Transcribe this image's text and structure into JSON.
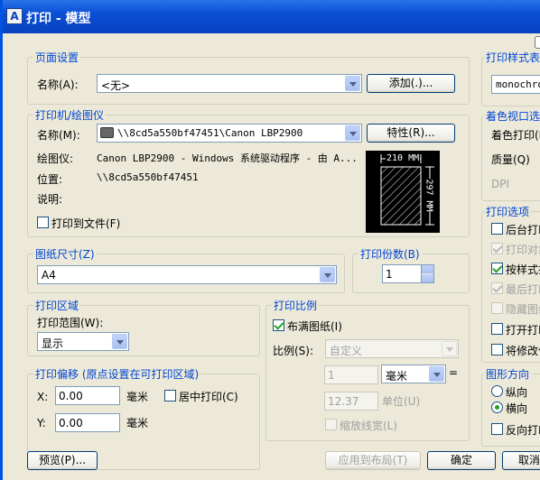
{
  "window": {
    "title": "打印 - 模型",
    "app_icon": "autocad-icon"
  },
  "page_setup": {
    "title": "页面设置",
    "name_label": "名称(A):",
    "name_value": "<无>",
    "add_button": "添加(.)..."
  },
  "printer": {
    "title": "打印机/绘图仪",
    "name_label": "名称(M):",
    "name_value": "\\\\8cd5a550bf47451\\Canon LBP2900",
    "properties_button": "特性(R)...",
    "plotter_label": "绘图仪:",
    "plotter_value": "Canon LBP2900 - Windows 系统驱动程序 - 由 A...",
    "location_label": "位置:",
    "location_value": "\\\\8cd5a550bf47451",
    "description_label": "说明:",
    "plot_to_file": "打印到文件(F)",
    "plot_to_file_checked": false
  },
  "preview": {
    "width_label": "210 MM",
    "height_label": "297 MM"
  },
  "paper_size": {
    "title": "图纸尺寸(Z)",
    "value": "A4"
  },
  "copies": {
    "title": "打印份数(B)",
    "value": "1"
  },
  "plot_area": {
    "title": "打印区域",
    "range_label": "打印范围(W):",
    "range_value": "显示"
  },
  "plot_offset": {
    "title": "打印偏移 (原点设置在可打印区域)",
    "x_label": "X:",
    "x_value": "0.00",
    "x_unit": "毫米",
    "y_label": "Y:",
    "y_value": "0.00",
    "y_unit": "毫米",
    "center": "居中打印(C)",
    "center_checked": false
  },
  "plot_scale": {
    "title": "打印比例",
    "fit": "布满图纸(I)",
    "fit_checked": true,
    "scale_label": "比例(S):",
    "scale_value": "自定义",
    "value1": "1",
    "unit": "毫米",
    "equals": "=",
    "value2": "12.37",
    "unit2": "单位(U)",
    "lineweights": "缩放线宽(L)",
    "lineweights_checked": false
  },
  "plot_style": {
    "title": "打印样式表",
    "value": "monochrome"
  },
  "shaded": {
    "title": "着色视口选项",
    "shade_label": "着色打印(D)",
    "quality_label": "质量(Q)",
    "dpi_label": "DPI"
  },
  "plot_options": {
    "title": "打印选项",
    "items": [
      {
        "label": "后台打印",
        "checked": false,
        "disabled": false
      },
      {
        "label": "打印对象线宽",
        "checked": true,
        "disabled": true
      },
      {
        "label": "按样式打印",
        "checked": true,
        "disabled": false
      },
      {
        "label": "最后打印",
        "checked": true,
        "disabled": true
      },
      {
        "label": "隐藏图纸空间",
        "checked": false,
        "disabled": true
      },
      {
        "label": "打开打印戳记",
        "checked": false,
        "disabled": false
      },
      {
        "label": "将修改保存",
        "checked": false,
        "disabled": false
      }
    ]
  },
  "orientation": {
    "title": "图形方向",
    "portrait": "纵向",
    "landscape": "横向",
    "upside_down": "反向打印",
    "selected": "landscape"
  },
  "buttons": {
    "preview": "预览(P)...",
    "apply": "应用到布局(T)",
    "ok": "确定",
    "cancel": "取消"
  },
  "info_icon": "i"
}
